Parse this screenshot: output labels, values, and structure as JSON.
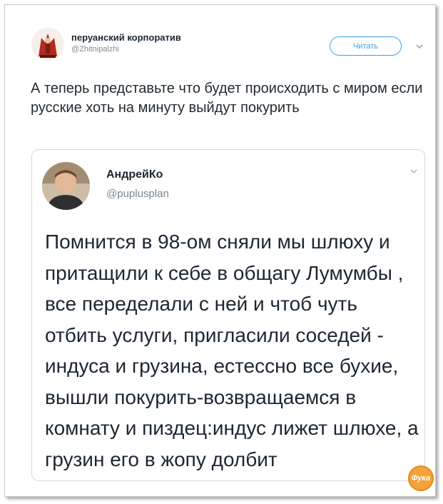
{
  "tweet": {
    "author_name": "перуанский корпоратив",
    "author_handle": "@Zhitnipalzhi",
    "follow_label": "Читать",
    "text": "А теперь представьте что будет происходить с миром если русские хоть на минуту выйдут покурить"
  },
  "quoted_tweet": {
    "author_name": "АндрейКо",
    "author_handle": "@puplusplan",
    "text": "Помнится в 98-ом сняли мы шлюху и притащили к себе в общагу Лумумбы , все переделали с ней и чтоб чуть отбить услуги, пригласили соседей - индуса и грузина, естессно все бухие, вышли покурить-возвращаемся в комнату и пиздец:индус лижет шлюхе, а грузин его в жопу долбит"
  },
  "watermark": {
    "label": "Фука"
  },
  "icons": {
    "avatar": "avatar-icon",
    "caret": "chevron-down-icon"
  },
  "colors": {
    "accent": "#3d9ee8",
    "text": "#1c2733",
    "muted": "#7f8a95",
    "watermark": "#f2a33a"
  }
}
